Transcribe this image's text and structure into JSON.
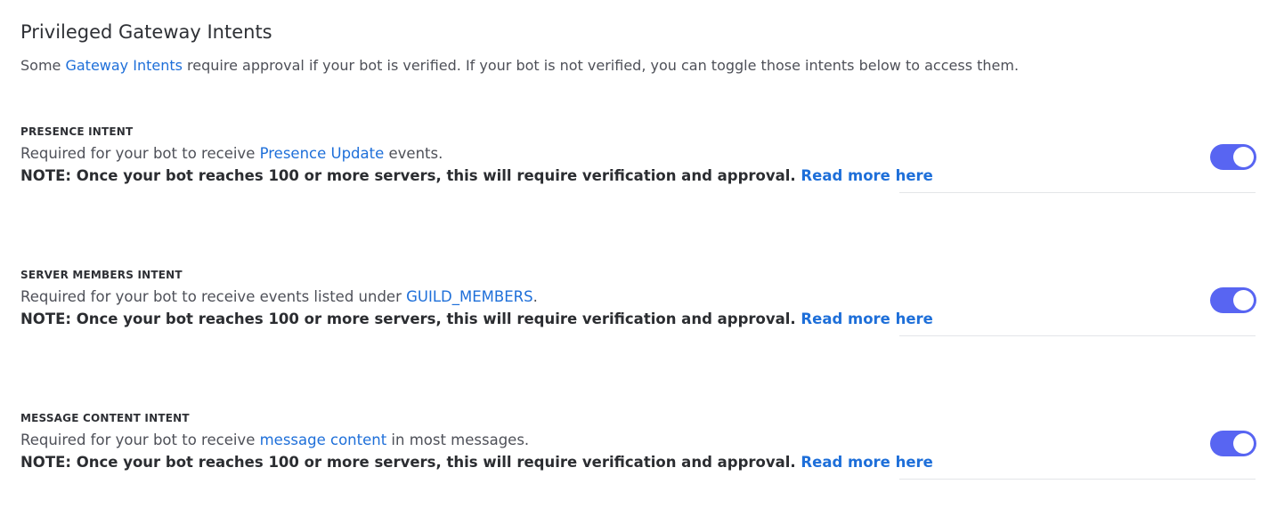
{
  "header": {
    "title": "Privileged Gateway Intents",
    "desc_prefix": "Some ",
    "desc_link": "Gateway Intents",
    "desc_suffix": " require approval if your bot is verified. If your bot is not verified, you can toggle those intents below to access them."
  },
  "intents": [
    {
      "label": "PRESENCE INTENT",
      "desc_prefix": "Required for your bot to receive ",
      "desc_link": "Presence Update",
      "desc_suffix": " events.",
      "note": "NOTE: Once your bot reaches 100 or more servers, this will require verification and approval.",
      "note_link": "Read more here",
      "enabled": true
    },
    {
      "label": "SERVER MEMBERS INTENT",
      "desc_prefix": "Required for your bot to receive events listed under ",
      "desc_link": "GUILD_MEMBERS",
      "desc_suffix": ".",
      "note": "NOTE: Once your bot reaches 100 or more servers, this will require verification and approval.",
      "note_link": "Read more here",
      "enabled": true
    },
    {
      "label": "MESSAGE CONTENT INTENT",
      "desc_prefix": "Required for your bot to receive ",
      "desc_link": "message content",
      "desc_suffix": " in most messages.",
      "note": "NOTE: Once your bot reaches 100 or more servers, this will require verification and approval.",
      "note_link": "Read more here",
      "enabled": true
    }
  ],
  "colors": {
    "accent": "#5865f2",
    "link": "#1e6fd9"
  }
}
